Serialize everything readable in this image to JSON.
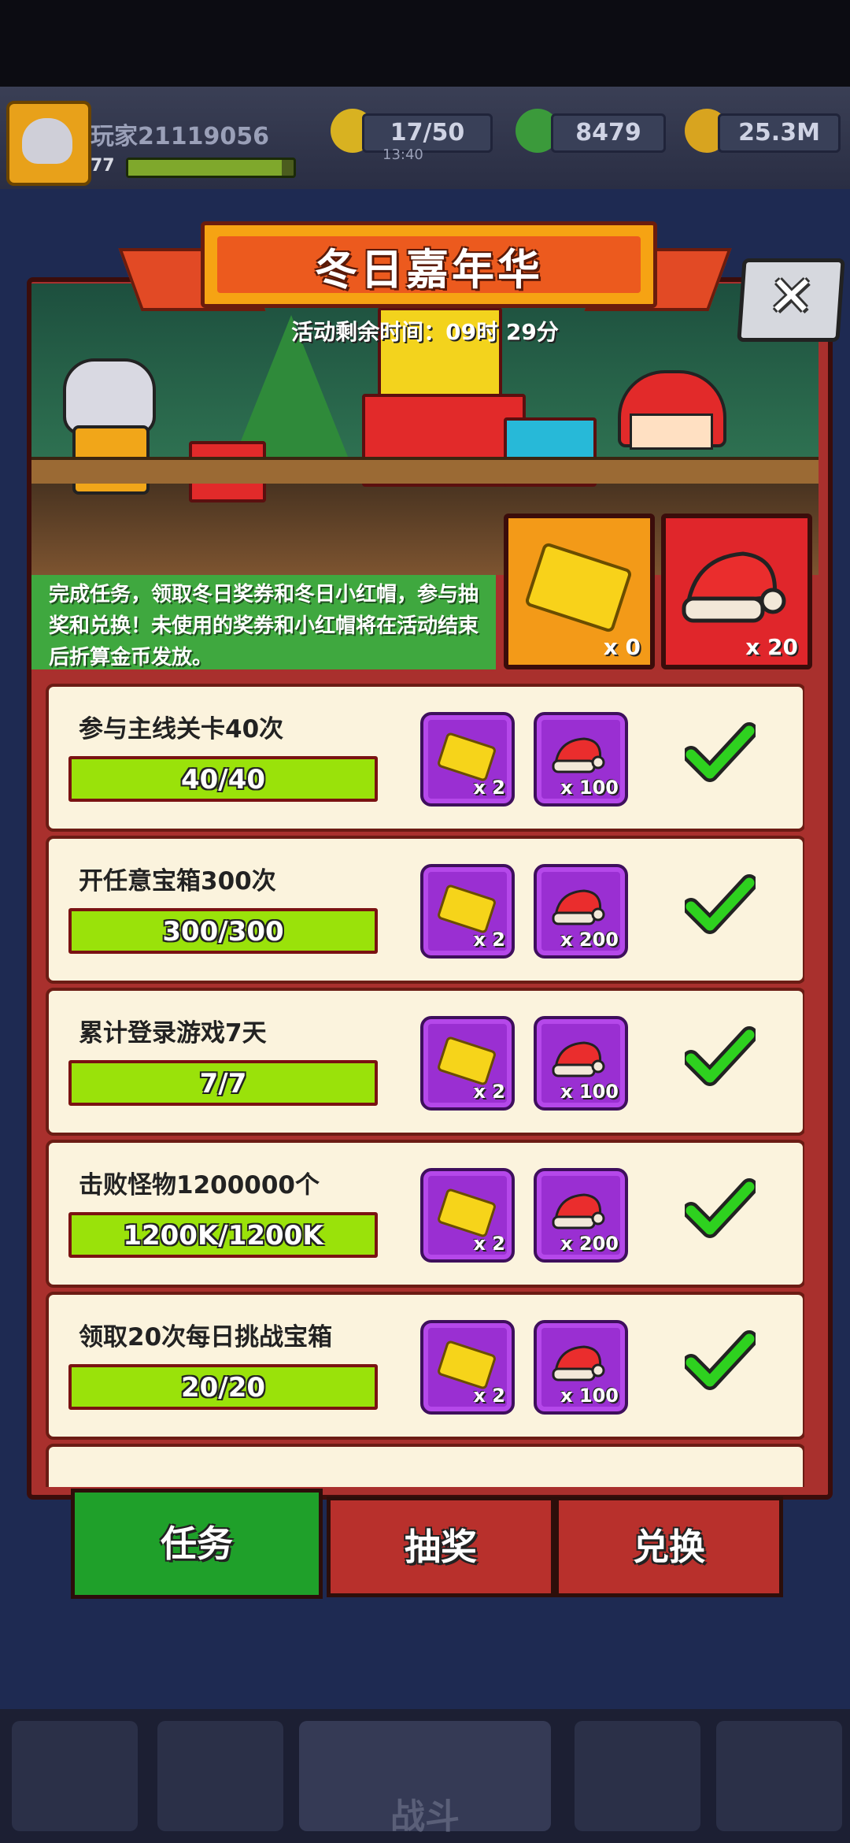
{
  "hud": {
    "player_name": "玩家21119056",
    "level": "77",
    "xp_progress": 0.93,
    "energy": "17/50",
    "energy_timer": "13:40",
    "gems": "8479",
    "coins": "25.3M"
  },
  "event": {
    "title": "冬日嘉年华",
    "timer_label": "活动剩余时间：09时 29分",
    "description": "完成任务，领取冬日奖券和冬日小红帽，参与抽奖和兑换！未使用的奖券和小红帽将在活动结束后折算金币发放。",
    "close_label": "✕",
    "ticket_count": "x 0",
    "hat_count": "x 20"
  },
  "tasks": [
    {
      "name": "参与主线关卡40次",
      "progress": "40/40",
      "ticket_reward": "x 2",
      "hat_reward": "x 100",
      "completed": true
    },
    {
      "name": "开任意宝箱300次",
      "progress": "300/300",
      "ticket_reward": "x 2",
      "hat_reward": "x 200",
      "completed": true
    },
    {
      "name": "累计登录游戏7天",
      "progress": "7/7",
      "ticket_reward": "x 2",
      "hat_reward": "x 100",
      "completed": true
    },
    {
      "name": "击败怪物1200000个",
      "progress": "1200K/1200K",
      "ticket_reward": "x 2",
      "hat_reward": "x 200",
      "completed": true
    },
    {
      "name": "领取20次每日挑战宝箱",
      "progress": "20/20",
      "ticket_reward": "x 2",
      "hat_reward": "x 100",
      "completed": true
    }
  ],
  "tabs": {
    "tasks": "任务",
    "lottery": "抽奖",
    "exchange": "兑换"
  },
  "bottom_nav": {
    "battle_label": "战斗"
  },
  "colors": {
    "modal_red": "#a9302d",
    "progress_green": "#9ae20a",
    "reward_purple": "#9a2fd2",
    "tab_active": "#1fa02a",
    "tab_inactive": "#b8302c"
  }
}
